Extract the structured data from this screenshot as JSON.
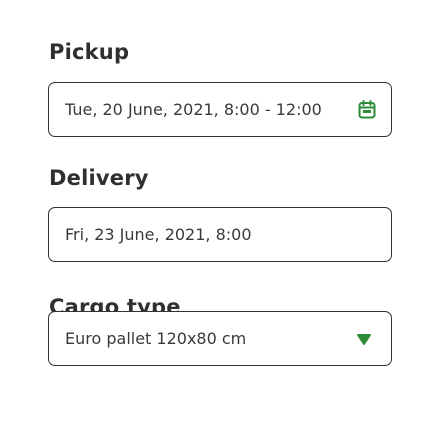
{
  "pickup": {
    "title": "Pickup",
    "value": "Tue, 20 June, 2021, 8:00 - 12:00"
  },
  "delivery": {
    "title": "Delivery",
    "value": "Fri, 23 June, 2021, 8:00"
  },
  "cargo": {
    "title": "Cargo type",
    "value": "Euro pallet 120x80 cm"
  },
  "colors": {
    "accent": "#2e8b3a",
    "border": "#333333",
    "text": "#2f2f2f"
  },
  "icons": {
    "pickup_icon": "calendar-icon",
    "cargo_icon": "chevron-down-icon"
  }
}
